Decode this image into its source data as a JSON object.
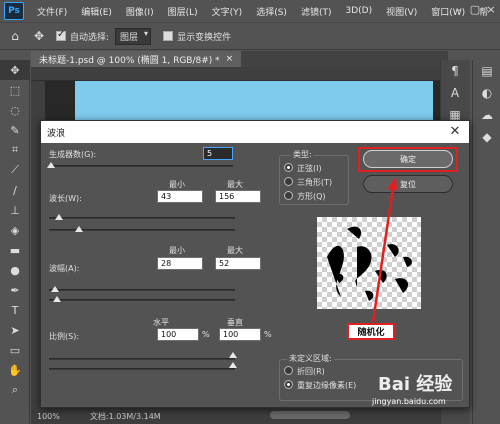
{
  "menubar": {
    "logo": "Ps",
    "items": [
      "文件(F)",
      "编辑(E)",
      "图像(I)",
      "图层(L)",
      "文字(Y)",
      "选择(S)",
      "滤镜(T)",
      "3D(D)",
      "视图(V)",
      "窗口(W)",
      "帮"
    ]
  },
  "options": {
    "auto_select_label": "自动选择:",
    "auto_select_value": "图层",
    "show_transform_label": "显示变换控件"
  },
  "document": {
    "tab_title": "未标题-1.psd @ 100% (椭圆 1, RGB/8#) *",
    "tab_close": "×"
  },
  "status": {
    "zoom": "100%",
    "doc_info": "文档:1.03M/3.14M"
  },
  "dialog": {
    "title": "波浪",
    "generators_label": "生成器数(G):",
    "generators_value": "5",
    "min_label": "最小",
    "max_label": "最大",
    "wavelength_label": "波长(W):",
    "wavelength_min": "43",
    "wavelength_max": "156",
    "amplitude_label": "波幅(A):",
    "amplitude_min": "28",
    "amplitude_max": "52",
    "scale_label": "比例(S):",
    "horizontal_label": "水平",
    "vertical_label": "垂直",
    "scale_h": "100",
    "scale_v": "100",
    "percent": "%",
    "type_label": "类型:",
    "type_options": [
      "正弦(I)",
      "三角形(T)",
      "方形(Q)"
    ],
    "type_selected": 0,
    "ok_label": "确定",
    "reset_label": "复位",
    "randomize_label": "随机化",
    "undefined_label": "未定义区域:",
    "undefined_options": [
      "折回(R)",
      "重复边缘像素(E)"
    ],
    "undefined_selected": 1
  },
  "watermark": {
    "text": "Bai 经验",
    "sub": "jingyan.baidu.com"
  },
  "colors": {
    "canvas": "#7ecbee",
    "highlight": "#e02020",
    "panel": "#535353"
  },
  "icons": {
    "toolbar": [
      "move-icon",
      "marquee-icon",
      "lasso-icon",
      "quick-select-icon",
      "crop-icon",
      "eyedropper-icon",
      "brush-icon",
      "stamp-icon",
      "eraser-icon",
      "gradient-icon",
      "dodge-icon",
      "pen-icon",
      "type-icon",
      "path-select-icon",
      "rectangle-icon",
      "hand-icon",
      "zoom-icon"
    ]
  }
}
